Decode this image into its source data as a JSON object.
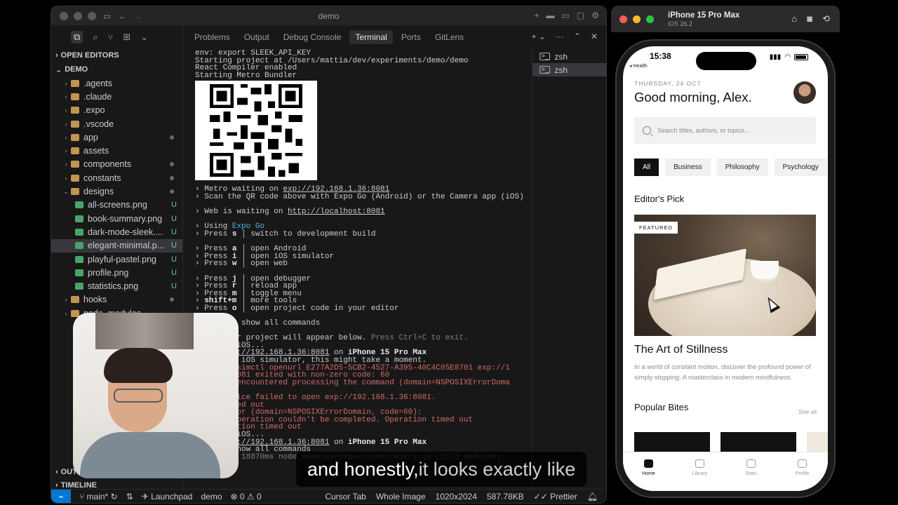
{
  "editor": {
    "window_title": "demo",
    "explorer": {
      "open_editors_label": "OPEN EDITORS",
      "project_label": "DEMO",
      "items": [
        {
          "name": ".agents",
          "type": "folder",
          "level": 1,
          "status": ""
        },
        {
          "name": ".claude",
          "type": "folder",
          "level": 1,
          "status": ""
        },
        {
          "name": ".expo",
          "type": "folder",
          "level": 1,
          "status": ""
        },
        {
          "name": ".vscode",
          "type": "folder",
          "level": 1,
          "status": ""
        },
        {
          "name": "app",
          "type": "folder",
          "level": 1,
          "status": "dot"
        },
        {
          "name": "assets",
          "type": "folder",
          "level": 1,
          "status": ""
        },
        {
          "name": "components",
          "type": "folder",
          "level": 1,
          "status": "dot"
        },
        {
          "name": "constants",
          "type": "folder",
          "level": 1,
          "status": "dot"
        },
        {
          "name": "designs",
          "type": "folder-open",
          "level": 1,
          "status": "dot"
        },
        {
          "name": "all-screens.png",
          "type": "image",
          "level": 2,
          "status": "U"
        },
        {
          "name": "book-summary.png",
          "type": "image",
          "level": 2,
          "status": "U"
        },
        {
          "name": "dark-mode-sleek....",
          "type": "image",
          "level": 2,
          "status": "U"
        },
        {
          "name": "elegant-minimal.p...",
          "type": "image",
          "level": 2,
          "status": "U",
          "selected": true
        },
        {
          "name": "playful-pastel.png",
          "type": "image",
          "level": 2,
          "status": "U"
        },
        {
          "name": "profile.png",
          "type": "image",
          "level": 2,
          "status": "U"
        },
        {
          "name": "statistics.png",
          "type": "image",
          "level": 2,
          "status": "U"
        },
        {
          "name": "hooks",
          "type": "folder",
          "level": 1,
          "status": "dot"
        },
        {
          "name": "node_modules",
          "type": "folder",
          "level": 1,
          "status": ""
        }
      ],
      "outline_label": "OUTLINE",
      "timeline_label": "TIMELINE"
    },
    "panel_tabs": [
      "Problems",
      "Output",
      "Debug Console",
      "Terminal",
      "Ports",
      "GitLens"
    ],
    "active_panel_tab": "Terminal",
    "terminal_sessions": [
      "zsh",
      "zsh"
    ],
    "terminal_lines_top": [
      [
        {
          "t": "env: export SLEEK_API_KEY"
        }
      ],
      [
        {
          "t": "Starting project at /Users/mattia/dev/experiments/demo/demo"
        }
      ],
      [
        {
          "t": "React Compiler enabled"
        }
      ],
      [
        {
          "t": "Starting Metro Bundler"
        }
      ]
    ],
    "terminal_lines_bottom": [
      [
        {
          "t": "› Metro waiting on "
        },
        {
          "t": "exp://192.168.1.36:8081",
          "c": "ul"
        }
      ],
      [
        {
          "t": "› Scan the QR code above with Expo Go (Android) or the Camera app (iOS)"
        }
      ],
      [
        {
          "t": ""
        }
      ],
      [
        {
          "t": "› Web is waiting on "
        },
        {
          "t": "http://localhost:8081",
          "c": "ul"
        }
      ],
      [
        {
          "t": ""
        }
      ],
      [
        {
          "t": "› Using "
        },
        {
          "t": "Expo Go",
          "c": "cyan"
        }
      ],
      [
        {
          "t": "› Press "
        },
        {
          "t": "s",
          "c": "bold"
        },
        {
          "t": " │ switch to development build"
        }
      ],
      [
        {
          "t": ""
        }
      ],
      [
        {
          "t": "› Press "
        },
        {
          "t": "a",
          "c": "bold"
        },
        {
          "t": " │ open Android"
        }
      ],
      [
        {
          "t": "› Press "
        },
        {
          "t": "i",
          "c": "bold"
        },
        {
          "t": " │ open iOS simulator"
        }
      ],
      [
        {
          "t": "› Press "
        },
        {
          "t": "w",
          "c": "bold"
        },
        {
          "t": " │ open web"
        }
      ],
      [
        {
          "t": ""
        }
      ],
      [
        {
          "t": "› Press "
        },
        {
          "t": "j",
          "c": "bold"
        },
        {
          "t": " │ open debugger"
        }
      ],
      [
        {
          "t": "› Press "
        },
        {
          "t": "r",
          "c": "bold"
        },
        {
          "t": " │ reload app"
        }
      ],
      [
        {
          "t": "› Press "
        },
        {
          "t": "m",
          "c": "bold"
        },
        {
          "t": " │ toggle menu"
        }
      ],
      [
        {
          "t": "› "
        },
        {
          "t": "shift+m",
          "c": "bold"
        },
        {
          "t": " │ more tools"
        }
      ],
      [
        {
          "t": "› Press "
        },
        {
          "t": "o",
          "c": "bold"
        },
        {
          "t": " │ open project code in your editor"
        }
      ],
      [
        {
          "t": ""
        }
      ],
      [
        {
          "t": "      ? │ show all commands"
        }
      ],
      [
        {
          "t": ""
        }
      ],
      [
        {
          "t": "      your project will appear below. "
        },
        {
          "t": "Press Ctrl+C to exit.",
          "c": "dim"
        }
      ],
      [
        {
          "t": "      on iOS..."
        }
      ],
      [
        {
          "t": "      "
        },
        {
          "t": "exp://192.168.1.36:8081",
          "c": "ul"
        },
        {
          "t": " on "
        },
        {
          "t": "iPhone 15 Pro Max",
          "c": "bold"
        }
      ],
      [
        {
          "t": "      the iOS simulator, this might take a moment."
        }
      ],
      [
        {
          "t": "      un simctl openurl E277A2D5-5CB2-4527-A395-40C4C05E8701 exp://1",
          "c": "red"
        }
      ],
      [
        {
          "t": "      6:8081 exited with non-zero code: 60",
          "c": "red"
        }
      ],
      [
        {
          "t": "      as encountered processing the command (domain=NSPOSIXErrorDoma",
          "c": "red"
        }
      ],
      [
        {
          "t": "      0):",
          "c": "red"
        }
      ],
      [
        {
          "t": "      device failed to open exp://192.168.1.36:8081.",
          "c": "red"
        }
      ],
      [
        {
          "t": "      timed out",
          "c": "red"
        }
      ],
      [
        {
          "t": "      error (domain=NSPOSIXErrorDomain, code=60):",
          "c": "red"
        }
      ],
      [
        {
          "t": "      e operation couldn't be completed. Operation timed out",
          "c": "red"
        }
      ],
      [
        {
          "t": "      eration timed out",
          "c": "red"
        }
      ],
      [
        {
          "t": "      on iOS..."
        }
      ],
      [
        {
          "t": "      "
        },
        {
          "t": "exp://192.168.1.36:8081",
          "c": "ul"
        },
        {
          "t": " on "
        },
        {
          "t": "iPhone 15 Pro Max",
          "c": "bold"
        }
      ],
      [
        {
          "t": "      │ show all commands"
        }
      ],
      [
        {
          "t": "      led 18870ms node_modules/expo-router/entry.js (1573 modules)",
          "c": "dim"
        }
      ]
    ],
    "status_bar": {
      "branch": "main*",
      "launchpad": "Launchpad",
      "project": "demo",
      "problems": "0",
      "warnings": "0",
      "cursor_tab": "Cursor Tab",
      "whole_image": "Whole Image",
      "dimensions": "1020x2024",
      "file_size": "587.78KB",
      "formatter": "Prettier"
    }
  },
  "subtitle": {
    "highlight": "and honestly,",
    "rest": " it looks exactly like"
  },
  "simulator": {
    "device_name": "iPhone 15 Pro Max",
    "os_version": "iOS 26.2",
    "app": {
      "time": "15:38",
      "back_label": "◂ Health",
      "date": "THURSDAY, 24 OCT",
      "greeting": "Good morning, Alex.",
      "search_placeholder": "Search titles, authors, or topics...",
      "categories": [
        "All",
        "Business",
        "Philosophy",
        "Psychology"
      ],
      "active_category": "All",
      "editors_pick_label": "Editor's Pick",
      "featured_badge": "FEATURED",
      "featured_title": "The Art of Stillness",
      "featured_desc": "In a world of constant motion, discover the profound power of simply stopping. A masterclass in modern mindfulness.",
      "popular_label": "Popular Bites",
      "see_all": "See all",
      "tabs": [
        "Home",
        "Library",
        "Stats",
        "Profile"
      ],
      "active_tab": "Home"
    }
  },
  "colors": {
    "accent_blue": "#0078d4",
    "untracked_green": "#73c991",
    "error_red": "#d16969",
    "link_cyan": "#4fb3d9"
  }
}
